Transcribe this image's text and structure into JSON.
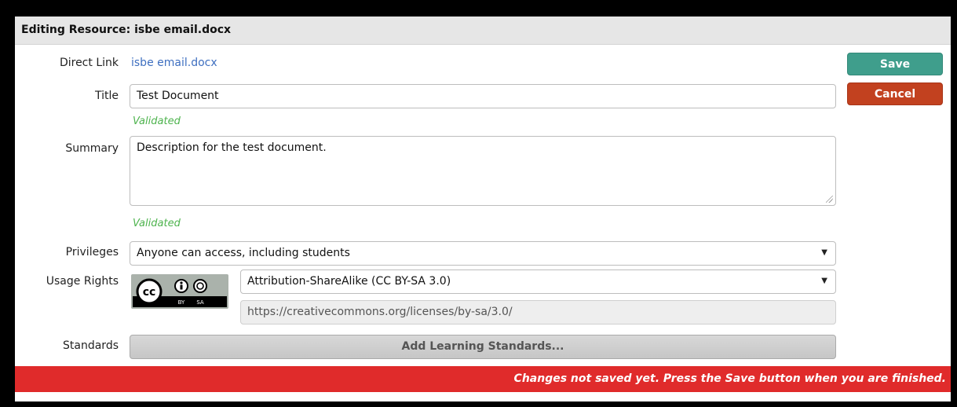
{
  "header": {
    "title": "Editing Resource: isbe email.docx"
  },
  "buttons": {
    "save": "Save",
    "cancel": "Cancel"
  },
  "fields": {
    "direct_link": {
      "label": "Direct Link",
      "value": "isbe email.docx"
    },
    "title": {
      "label": "Title",
      "value": "Test Document",
      "status": "Validated"
    },
    "summary": {
      "label": "Summary",
      "value": "Description for the test document.",
      "status": "Validated"
    },
    "privileges": {
      "label": "Privileges",
      "value": "Anyone can access, including students"
    },
    "usage_rights": {
      "label": "Usage Rights",
      "license": "Attribution-ShareAlike (CC BY-SA 3.0)",
      "url": "https://creativecommons.org/licenses/by-sa/3.0/",
      "badge_text": {
        "cc": "cc",
        "by": "BY",
        "sa": "SA"
      }
    },
    "standards": {
      "label": "Standards",
      "button": "Add Learning Standards..."
    }
  },
  "banner": {
    "text": "Changes not saved yet. Press the Save button when you are finished."
  },
  "colors": {
    "save": "#3f9e8c",
    "cancel": "#c2411f",
    "banner": "#e02b2b",
    "validated": "#4db34d",
    "link": "#3e6fc0"
  }
}
